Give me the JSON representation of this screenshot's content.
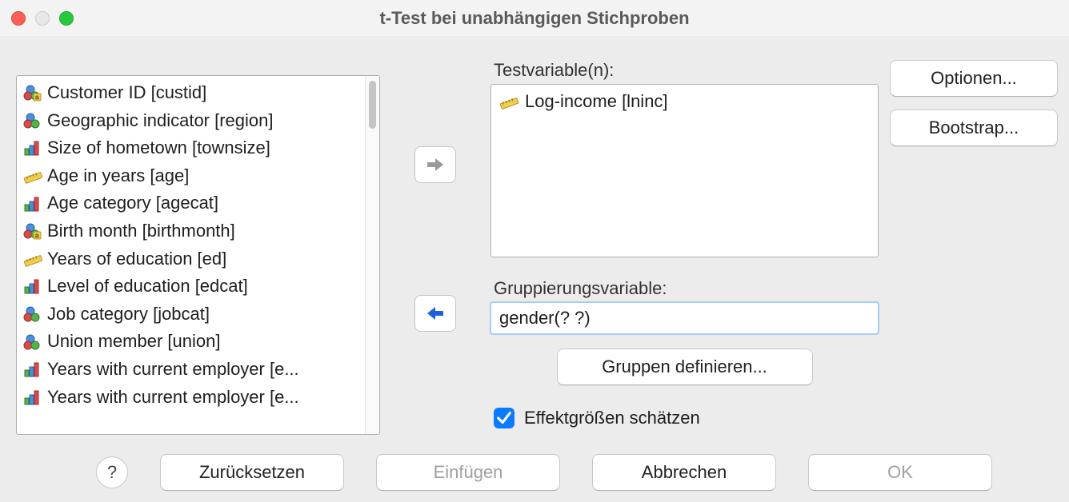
{
  "title": "t-Test bei unabhängigen Stichproben",
  "labels": {
    "test_vars": "Testvariable(n):",
    "group_var": "Gruppierungsvariable:",
    "effect_sizes": "Effektgrößen schätzen"
  },
  "variables": [
    {
      "icon": "nominal",
      "label": "Customer ID [custid]"
    },
    {
      "icon": "nominal",
      "label": "Geographic indicator [region]"
    },
    {
      "icon": "ordinal",
      "label": "Size of hometown [townsize]"
    },
    {
      "icon": "scale",
      "label": "Age in years [age]"
    },
    {
      "icon": "ordinal",
      "label": "Age category [agecat]"
    },
    {
      "icon": "nominal",
      "label": "Birth month [birthmonth]"
    },
    {
      "icon": "scale",
      "label": "Years of education [ed]"
    },
    {
      "icon": "ordinal",
      "label": "Level of education [edcat]"
    },
    {
      "icon": "nominal",
      "label": "Job category [jobcat]"
    },
    {
      "icon": "nominal",
      "label": "Union member [union]"
    },
    {
      "icon": "ordinal",
      "label": "Years with current employer [e..."
    },
    {
      "icon": "ordinal",
      "label": "Years with current employer [e..."
    }
  ],
  "test_variables": [
    {
      "icon": "scale",
      "label": "Log-income [lninc]"
    }
  ],
  "group_value": "gender(? ?)",
  "effect_sizes_checked": true,
  "buttons": {
    "options": "Optionen...",
    "bootstrap": "Bootstrap...",
    "define_groups": "Gruppen definieren...",
    "reset": "Zurücksetzen",
    "paste": "Einfügen",
    "cancel": "Abbrechen",
    "ok": "OK",
    "help": "?"
  }
}
